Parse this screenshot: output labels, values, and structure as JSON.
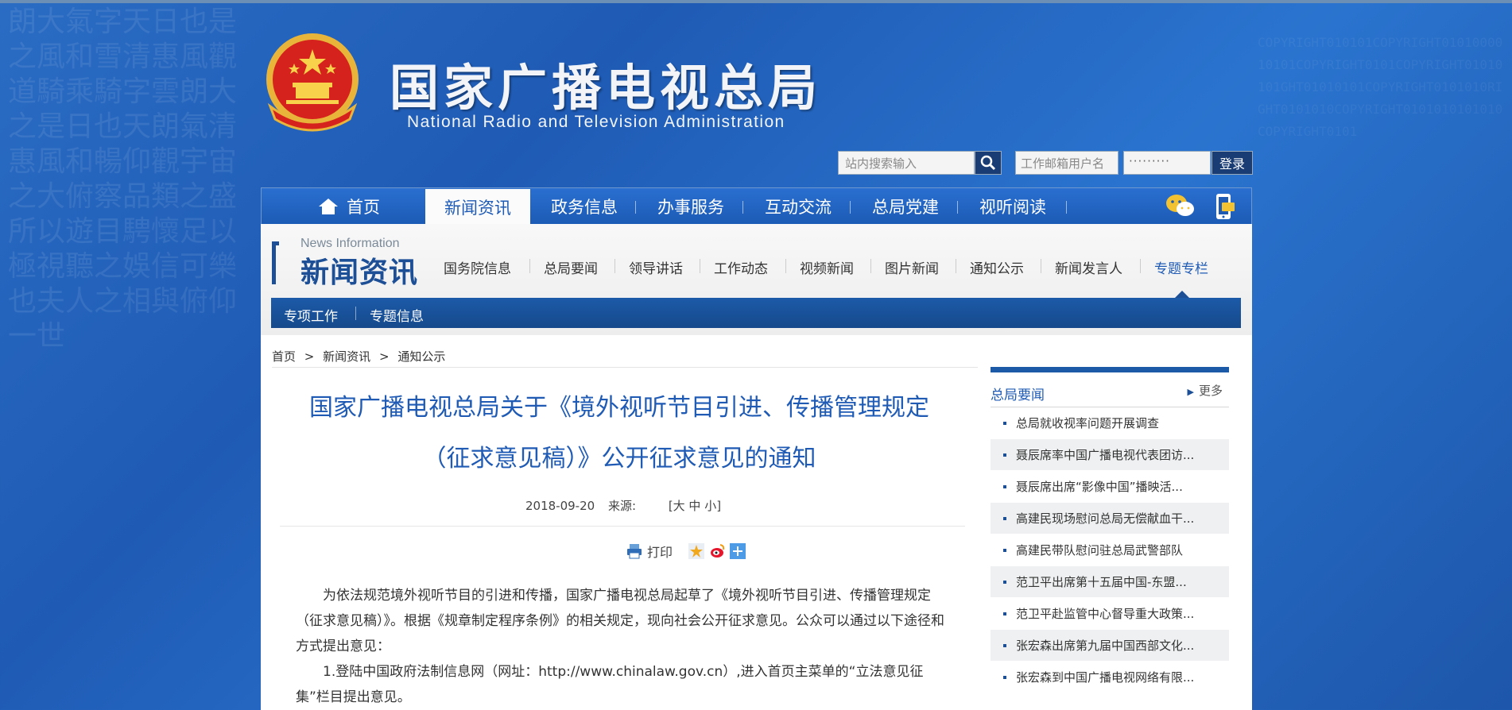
{
  "header": {
    "site_title": "国家广播电视总局",
    "site_subtitle": "National Radio and Television Administration",
    "search_placeholder": "站内搜索输入",
    "mail_placeholder": "工作邮箱用户名",
    "password_mask": "·········",
    "login_label": "登录"
  },
  "mainnav": {
    "items": [
      {
        "label": "首页"
      },
      {
        "label": "新闻资讯"
      },
      {
        "label": "政务信息"
      },
      {
        "label": "办事服务"
      },
      {
        "label": "互动交流"
      },
      {
        "label": "总局党建"
      },
      {
        "label": "视听阅读"
      }
    ]
  },
  "section": {
    "en": "News Information",
    "cn": "新闻资讯",
    "subnav": [
      {
        "label": "国务院信息"
      },
      {
        "label": "总局要闻"
      },
      {
        "label": "领导讲话"
      },
      {
        "label": "工作动态"
      },
      {
        "label": "视频新闻"
      },
      {
        "label": "图片新闻"
      },
      {
        "label": "通知公示"
      },
      {
        "label": "新闻发言人"
      },
      {
        "label": "专题专栏"
      }
    ],
    "bluebar": [
      {
        "label": "专项工作"
      },
      {
        "label": "专题信息"
      }
    ]
  },
  "breadcrumb": {
    "items": [
      "首页",
      ">",
      "新闻资讯",
      ">",
      "通知公示"
    ]
  },
  "article": {
    "title_line1": "国家广播电视总局关于《境外视听节目引进、传播管理规定",
    "title_line2": "（征求意见稿）》公开征求意见的通知",
    "date": "2018-09-20",
    "source_label": "来源:",
    "font_size_label": "[大 中 小]",
    "print_label": "打印",
    "para1": "为依法规范境外视听节目的引进和传播，国家广播电视总局起草了《境外视听节目引进、传播管理规定（征求意见稿）》。根据《规章制定程序条例》的相关规定，现向社会公开征求意见。公众可以通过以下途径和方式提出意见：",
    "para2": "1.登陆中国政府法制信息网（网址：http://www.chinalaw.gov.cn）,进入首页主菜单的“立法意见征集”栏目提出意见。"
  },
  "sidebar": {
    "title": "总局要闻",
    "more_label": "更多",
    "items": [
      {
        "text": "总局就收视率问题开展调查"
      },
      {
        "text": "聂辰席率中国广播电视代表团访..."
      },
      {
        "text": "聂辰席出席“影像中国”播映活..."
      },
      {
        "text": "高建民现场慰问总局无偿献血干..."
      },
      {
        "text": "高建民带队慰问驻总局武警部队"
      },
      {
        "text": "范卫平出席第十五届中国-东盟..."
      },
      {
        "text": "范卫平赴监管中心督导重大政策..."
      },
      {
        "text": "张宏森出席第九届中国西部文化..."
      },
      {
        "text": "张宏森到中国广播电视网络有限..."
      }
    ]
  },
  "colors": {
    "background_blue": "#2a6cc4",
    "nav_blue": "#1f5bb5",
    "dark_blue": "#1c4f96"
  }
}
